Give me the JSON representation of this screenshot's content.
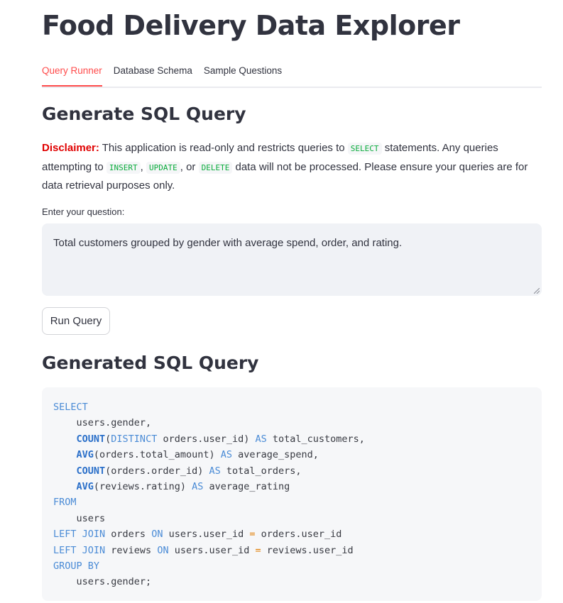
{
  "app": {
    "title": "Food Delivery Data Explorer"
  },
  "tabs": [
    {
      "label": "Query Runner",
      "active": true
    },
    {
      "label": "Database Schema",
      "active": false
    },
    {
      "label": "Sample Questions",
      "active": false
    }
  ],
  "generate": {
    "heading": "Generate SQL Query",
    "disclaimer": {
      "label": "Disclaimer:",
      "text_1": " This application is read-only and restricts queries to ",
      "code_1": "SELECT",
      "text_2": " statements. Any queries attempting to ",
      "code_2": "INSERT",
      "text_3": ", ",
      "code_3": "UPDATE",
      "text_4": ", or ",
      "code_4": "DELETE",
      "text_5": " data will not be processed. Please ensure your queries are for data retrieval purposes only."
    },
    "question_label": "Enter your question:",
    "question_value": "Total customers grouped by gender with average spend, order, and rating.",
    "run_button": "Run Query"
  },
  "result": {
    "heading": "Generated SQL Query",
    "sql_lines": [
      [
        {
          "t": "kw",
          "v": "SELECT"
        }
      ],
      [
        {
          "t": "",
          "v": "    users.gender,"
        }
      ],
      [
        {
          "t": "",
          "v": "    "
        },
        {
          "t": "fn",
          "v": "COUNT"
        },
        {
          "t": "",
          "v": "("
        },
        {
          "t": "kw",
          "v": "DISTINCT"
        },
        {
          "t": "",
          "v": " orders.user_id) "
        },
        {
          "t": "kw",
          "v": "AS"
        },
        {
          "t": "",
          "v": " total_customers,"
        }
      ],
      [
        {
          "t": "",
          "v": "    "
        },
        {
          "t": "fn",
          "v": "AVG"
        },
        {
          "t": "",
          "v": "(orders.total_amount) "
        },
        {
          "t": "kw",
          "v": "AS"
        },
        {
          "t": "",
          "v": " average_spend,"
        }
      ],
      [
        {
          "t": "",
          "v": "    "
        },
        {
          "t": "fn",
          "v": "COUNT"
        },
        {
          "t": "",
          "v": "(orders.order_id) "
        },
        {
          "t": "kw",
          "v": "AS"
        },
        {
          "t": "",
          "v": " total_orders,"
        }
      ],
      [
        {
          "t": "",
          "v": "    "
        },
        {
          "t": "fn",
          "v": "AVG"
        },
        {
          "t": "",
          "v": "(reviews.rating) "
        },
        {
          "t": "kw",
          "v": "AS"
        },
        {
          "t": "",
          "v": " average_rating"
        }
      ],
      [
        {
          "t": "kw",
          "v": "FROM"
        }
      ],
      [
        {
          "t": "",
          "v": "    users"
        }
      ],
      [
        {
          "t": "kw",
          "v": "LEFT JOIN"
        },
        {
          "t": "",
          "v": " orders "
        },
        {
          "t": "kw",
          "v": "ON"
        },
        {
          "t": "",
          "v": " users.user_id "
        },
        {
          "t": "op",
          "v": "="
        },
        {
          "t": "",
          "v": " orders.user_id"
        }
      ],
      [
        {
          "t": "kw",
          "v": "LEFT JOIN"
        },
        {
          "t": "",
          "v": " reviews "
        },
        {
          "t": "kw",
          "v": "ON"
        },
        {
          "t": "",
          "v": " users.user_id "
        },
        {
          "t": "op",
          "v": "="
        },
        {
          "t": "",
          "v": " reviews.user_id"
        }
      ],
      [
        {
          "t": "kw",
          "v": "GROUP BY"
        }
      ],
      [
        {
          "t": "",
          "v": "    users.gender;"
        }
      ]
    ]
  },
  "colors": {
    "accent": "#ff4b4b",
    "warning": "#e00000",
    "inline_code": "#09ab3b",
    "sql_keyword": "#4a8bd6",
    "sql_operator": "#e07b00"
  }
}
